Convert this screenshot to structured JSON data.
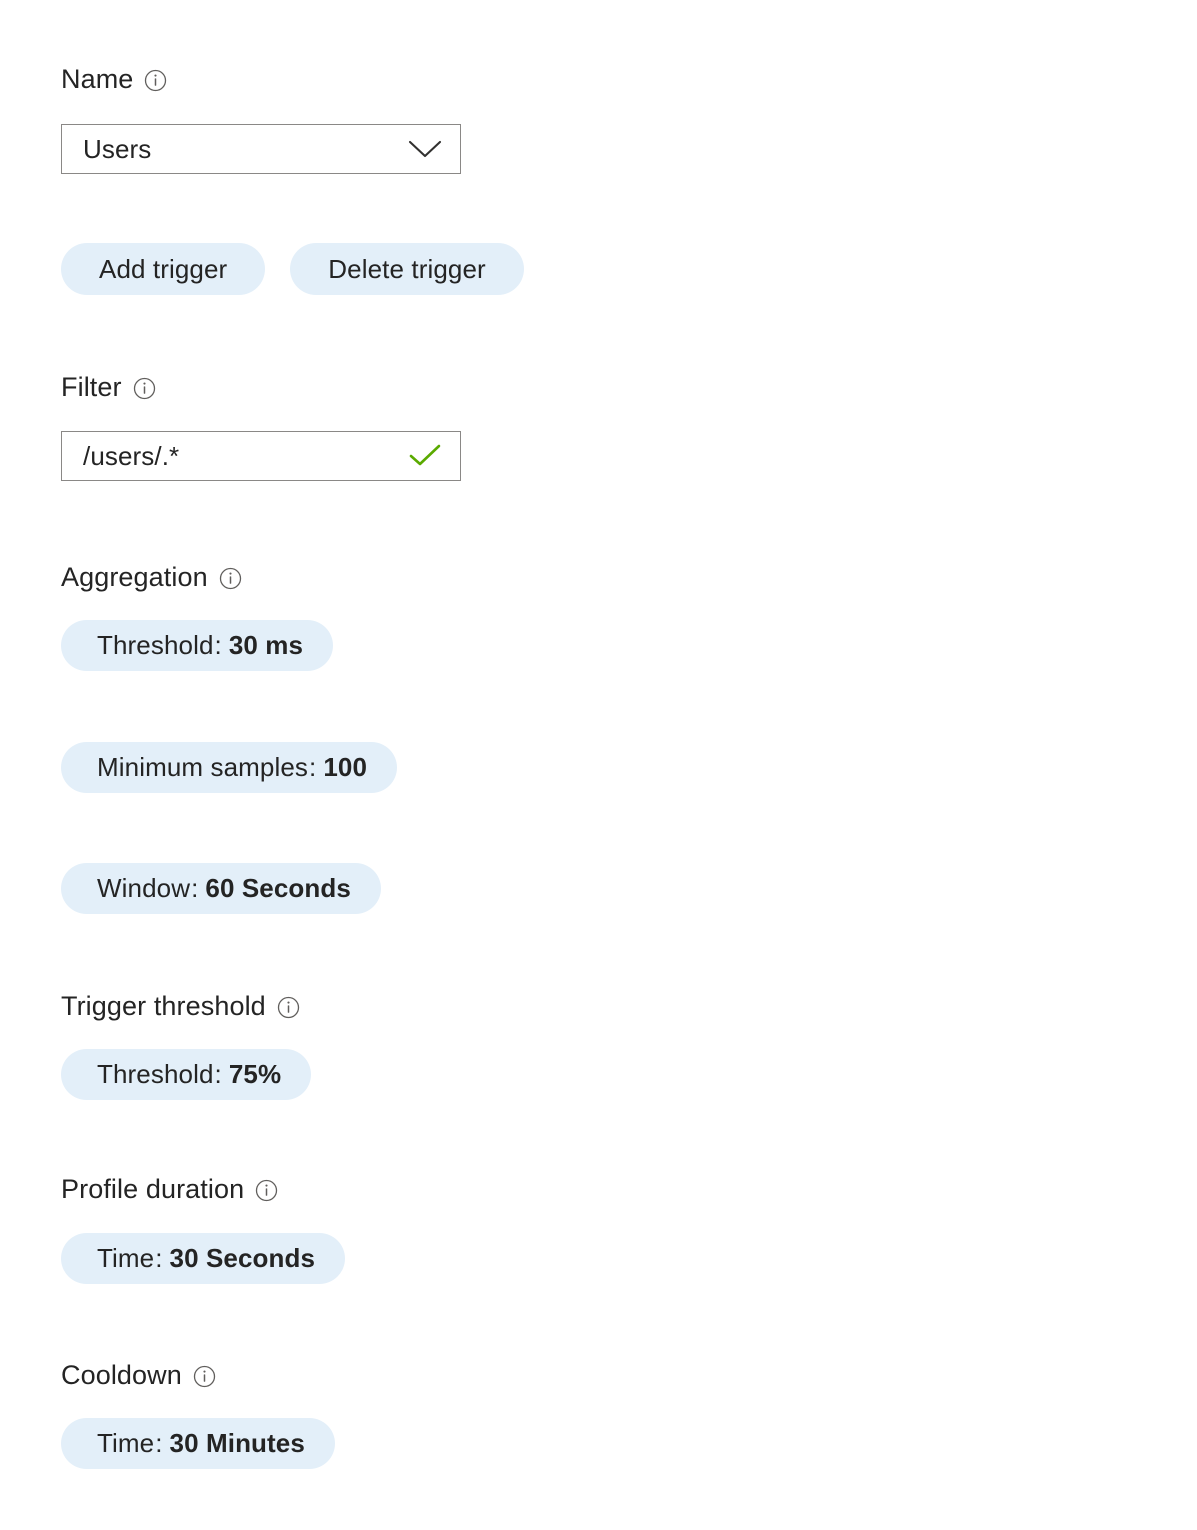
{
  "fields": {
    "name": {
      "label": "Name",
      "info_icon": "info-circle-icon",
      "value": "Users",
      "dropdown_icon": "chevron-down-icon"
    },
    "filter": {
      "label": "Filter",
      "info_icon": "info-circle-icon",
      "value": "/users/.*",
      "valid_icon": "checkmark-icon",
      "valid_color": "#5aaa00"
    },
    "aggregation": {
      "label": "Aggregation",
      "info_icon": "info-circle-icon",
      "chips": [
        {
          "label": "Threshold",
          "separator": ":",
          "value": "30 ms"
        },
        {
          "label": "Minimum samples",
          "separator": ":",
          "value": "100"
        },
        {
          "label": "Window",
          "separator": ":",
          "value": "60 Seconds"
        }
      ]
    },
    "trigger_threshold": {
      "label": "Trigger threshold",
      "info_icon": "info-circle-icon",
      "chips": [
        {
          "label": "Threshold",
          "separator": ":",
          "value": "75%"
        }
      ]
    },
    "profile_duration": {
      "label": "Profile duration",
      "info_icon": "info-circle-icon",
      "chips": [
        {
          "label": "Time",
          "separator": ":",
          "value": "30 Seconds"
        }
      ]
    },
    "cooldown": {
      "label": "Cooldown",
      "info_icon": "info-circle-icon",
      "chips": [
        {
          "label": "Time",
          "separator": ":",
          "value": "30 Minutes"
        }
      ]
    }
  },
  "buttons": {
    "add_trigger": "Add trigger",
    "delete_trigger": "Delete trigger"
  },
  "colors": {
    "chip_background": "#e3eff9",
    "text": "#242424",
    "input_border": "#8a8886",
    "valid_check": "#5aaa00"
  }
}
